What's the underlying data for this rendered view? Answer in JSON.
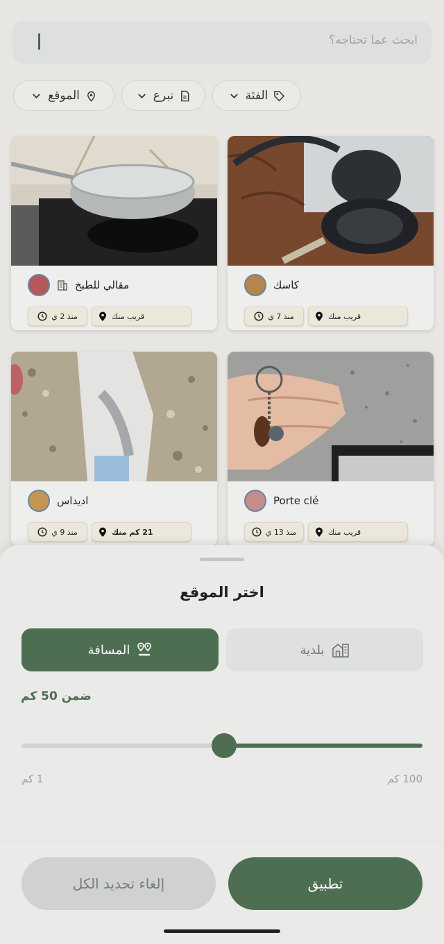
{
  "search": {
    "placeholder": "ابحث عما تحتاجه؟"
  },
  "filters": {
    "category": "الفئة",
    "type": "تبرع",
    "location": "الموقع"
  },
  "cards": [
    {
      "title": "مقالي للطبخ",
      "distance": "قريب منك",
      "time": "منذ 2 ي"
    },
    {
      "title": "كاسك",
      "distance": "قريب منك",
      "time": "منذ 7 ي"
    },
    {
      "title": "اديداس",
      "distance": "21 كم منك",
      "time": "منذ 9 ي"
    },
    {
      "title": "Porte clé",
      "distance": "قريب منك",
      "time": "منذ 13 ي"
    }
  ],
  "sheet": {
    "title": "اختر الموقع",
    "tab_distance": "المسافة",
    "tab_municipality": "بلدية",
    "within": "ضمن 50 كم",
    "min_label": "1 كم",
    "max_label": "100 كم",
    "slider_value_km": 50,
    "slider_min_km": 1,
    "slider_max_km": 100,
    "apply": "تطبيق",
    "clear_all": "إلغاء تحديد الكل"
  },
  "colors": {
    "accent": "#4e6e52",
    "background": "#ecebe7"
  }
}
